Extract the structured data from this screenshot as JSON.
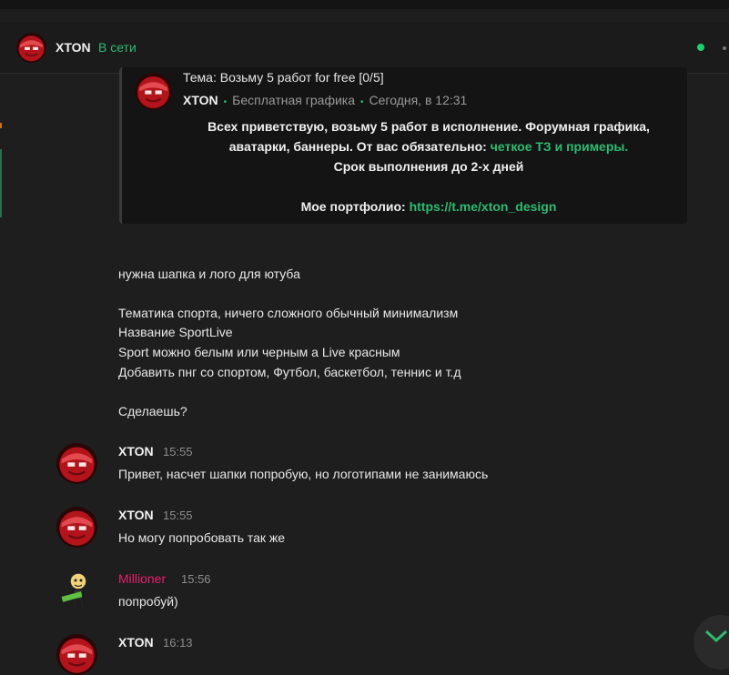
{
  "header": {
    "name": "XTON",
    "status": "В сети"
  },
  "quote": {
    "theme": "Тема: Возьму 5 работ for free [0/5]",
    "author": "XTON",
    "section": "Бесплатная графика",
    "date": "Сегодня, в 12:31",
    "line1": "Всех приветствую, возьму 5 работ в исполнение. Форумная графика,",
    "line2_prefix": "аватарки, баннеры. От вас обязательно: ",
    "line2_green": "четкое ТЗ и примеры.",
    "line3": "Срок выполнения до 2-х дней",
    "portfolio_label": "Мое портфолио: ",
    "portfolio_link": "https://t.me/xton_design"
  },
  "request": {
    "l1": "нужна шапка и лого для ютуба",
    "l2": "Тематика спорта, ничего сложного обычный минимализм",
    "l3": "Название SportLive",
    "l4": "Sport можно белым или черным а Live красным",
    "l5": "Добавить пнг со спортом, Футбол, баскетбол, теннис и т.д",
    "l6": "Сделаешь?"
  },
  "messages": [
    {
      "author": "XTON",
      "time": "15:55",
      "text": "Привет, насчет шапки попробую, но логотипами не занимаюсь"
    },
    {
      "author": "XTON",
      "time": "15:55",
      "text": "Но могу попробовать так же"
    },
    {
      "author": "Millioner",
      "time": "15:56",
      "text": "попробуй)"
    },
    {
      "author": "XTON",
      "time": "16:13",
      "text": ""
    }
  ],
  "colors": {
    "accent": "#2dbb72",
    "pink_user": "#e8206d",
    "background": "#1e1e1e"
  },
  "icons": {
    "scroll_down": "chevron-down-icon"
  }
}
